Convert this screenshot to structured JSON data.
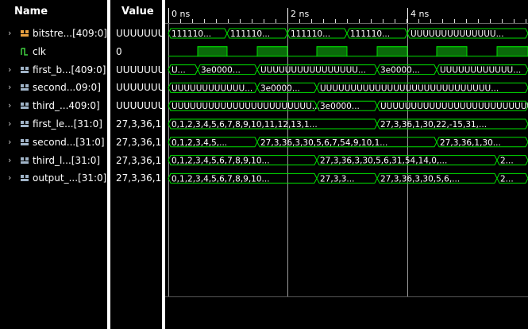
{
  "header": {
    "name_label": "Name",
    "value_label": "Value"
  },
  "timeline": {
    "labels": [
      "0 ns",
      "2 ns",
      "4 ns"
    ]
  },
  "signals": [
    {
      "name": "bitstre...[409:0]",
      "value": "UUUUUUU",
      "icon": "bus-orange-icon",
      "expandable": true,
      "selected": true
    },
    {
      "name": "clk",
      "value": "0",
      "icon": "clock-signal-icon",
      "expandable": false
    },
    {
      "name": "first_b...[409:0]",
      "value": "UUUUUUU",
      "icon": "bus-icon",
      "expandable": true
    },
    {
      "name": "second...09:0]",
      "value": "UUUUUUU",
      "icon": "bus-icon",
      "expandable": true
    },
    {
      "name": "third_...409:0]",
      "value": "UUUUUUU",
      "icon": "bus-icon",
      "expandable": true
    },
    {
      "name": "first_le...[31:0]",
      "value": "27,3,36,1",
      "icon": "bus-icon",
      "expandable": true
    },
    {
      "name": "second...[31:0]",
      "value": "27,3,36,1",
      "icon": "bus-icon",
      "expandable": true
    },
    {
      "name": "third_l...[31:0]",
      "value": "27,3,36,1",
      "icon": "bus-icon",
      "expandable": true
    },
    {
      "name": "output_...[31:0]",
      "value": "27,3,36,1",
      "icon": "bus-icon",
      "expandable": true
    }
  ],
  "waveforms": {
    "bitstream": [
      "111110...",
      "111110...",
      "111110...",
      "111110...",
      "UUUUUUUUUUUUUU..."
    ],
    "first_b": [
      "U...",
      "3e0000...",
      "UUUUUUUUUUUUUUUU...",
      "3e0000...",
      "UUUUUUUUUUUU..."
    ],
    "second": [
      "UUUUUUUUUUUU...",
      "3e0000...",
      "UUUUUUUUUUUUUUUUUUUUUUUUUUUU..."
    ],
    "third": [
      "UUUUUUUUUUUUUUUUUUUUUUU...",
      "3e0000...",
      "UUUUUUUUUUUUUUUUUUUUUUUUUUU..."
    ],
    "first_le": [
      "0,1,2,3,4,5,6,7,8,9,10,11,12,13,1...",
      "27,3,36,1,30,22,-15,31,..."
    ],
    "second_le": [
      "0,1,2,3,4,5,...",
      "27,3,36,3,30,5,6,7,54,9,10,1...",
      "27,3,36,1,30..."
    ],
    "third_le": [
      "0,1,2,3,4,5,6,7,8,9,10...",
      "27,3,36,3,30,5,6,31,54,14,0,...",
      "2..."
    ],
    "output": [
      "0,1,2,3,4,5,6,7,8,9,10...",
      "27,3,3...",
      "27,3,36,3,30,5,6,...",
      "2..."
    ]
  },
  "colors": {
    "wave": "#00e000",
    "grid": "#9a9a9a",
    "icon_bus": "#a0b4c8",
    "icon_bus_sel": "#e8a040"
  }
}
